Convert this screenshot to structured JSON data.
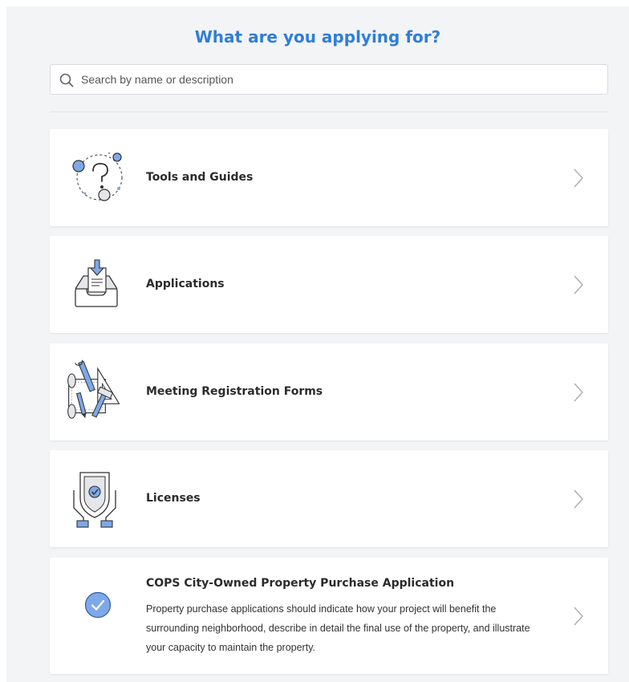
{
  "header": {
    "title": "What are you applying for?"
  },
  "search": {
    "placeholder": "Search by name or description",
    "icon": "search-icon"
  },
  "cards": [
    {
      "label": "Tools and Guides",
      "icon": "help-question-icon"
    },
    {
      "label": "Applications",
      "icon": "inbox-document-icon"
    },
    {
      "label": "Meeting Registration Forms",
      "icon": "blueprint-tools-icon"
    },
    {
      "label": "Licenses",
      "icon": "shield-hands-icon"
    },
    {
      "label": "COPS City-Owned Property Purchase Application",
      "icon": "check-circle-icon",
      "description": "Property purchase applications should indicate how your project will benefit the surrounding neighborhood, describe in detail the final use of the property, and illustrate your capacity to maintain the property."
    }
  ],
  "colors": {
    "accent": "#2f7ed8",
    "illustration_fill": "#7ea8e8",
    "background": "#f3f4f6",
    "card": "#ffffff"
  }
}
